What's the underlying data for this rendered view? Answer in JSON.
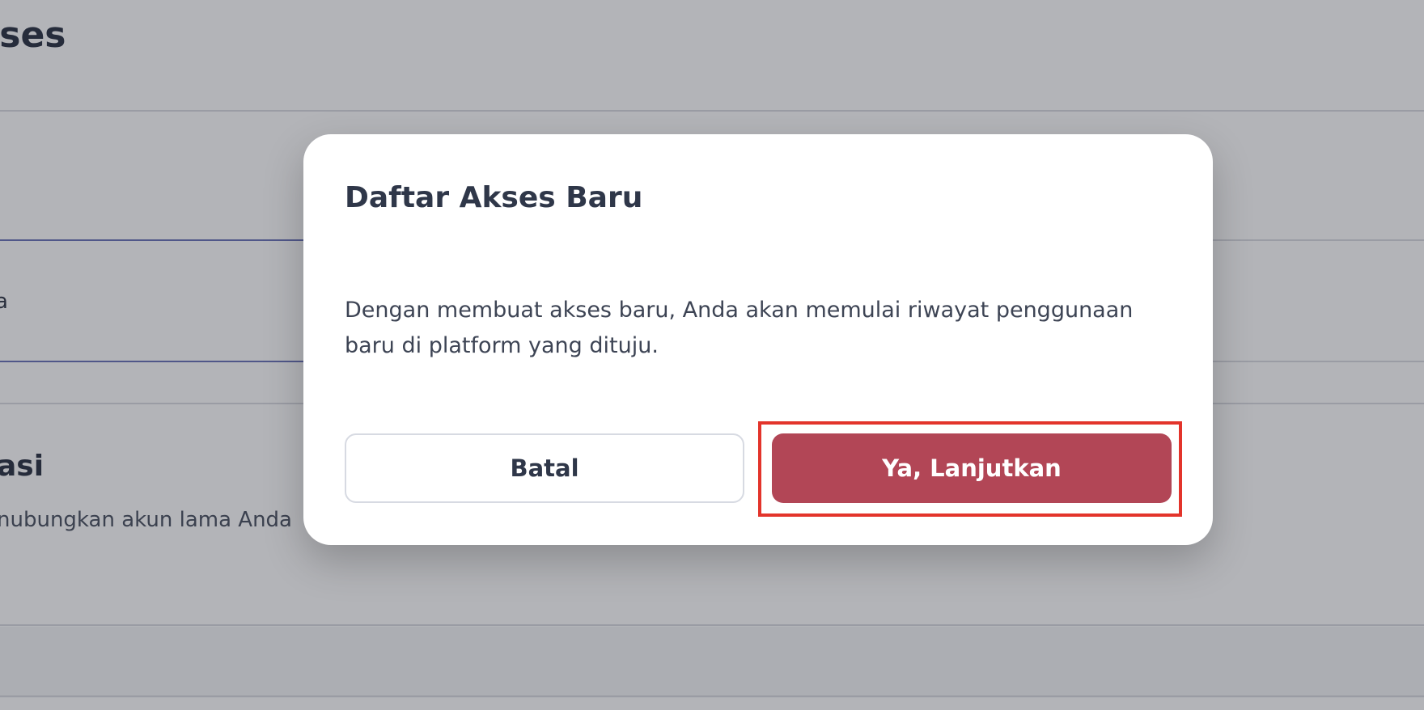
{
  "background": {
    "page_title": "kses",
    "input_value": "a",
    "section_title": "asi",
    "section_description": "nubungkan akun lama Anda"
  },
  "modal": {
    "title": "Daftar Akses Baru",
    "body": "Dengan membuat akses baru, Anda akan memulai riwayat penggunaan baru di platform yang dituju.",
    "cancel_label": "Batal",
    "confirm_label": "Ya, Lanjutkan"
  },
  "colors": {
    "primary": "#b24656",
    "highlight": "#e3342b",
    "text": "#2f3749"
  }
}
